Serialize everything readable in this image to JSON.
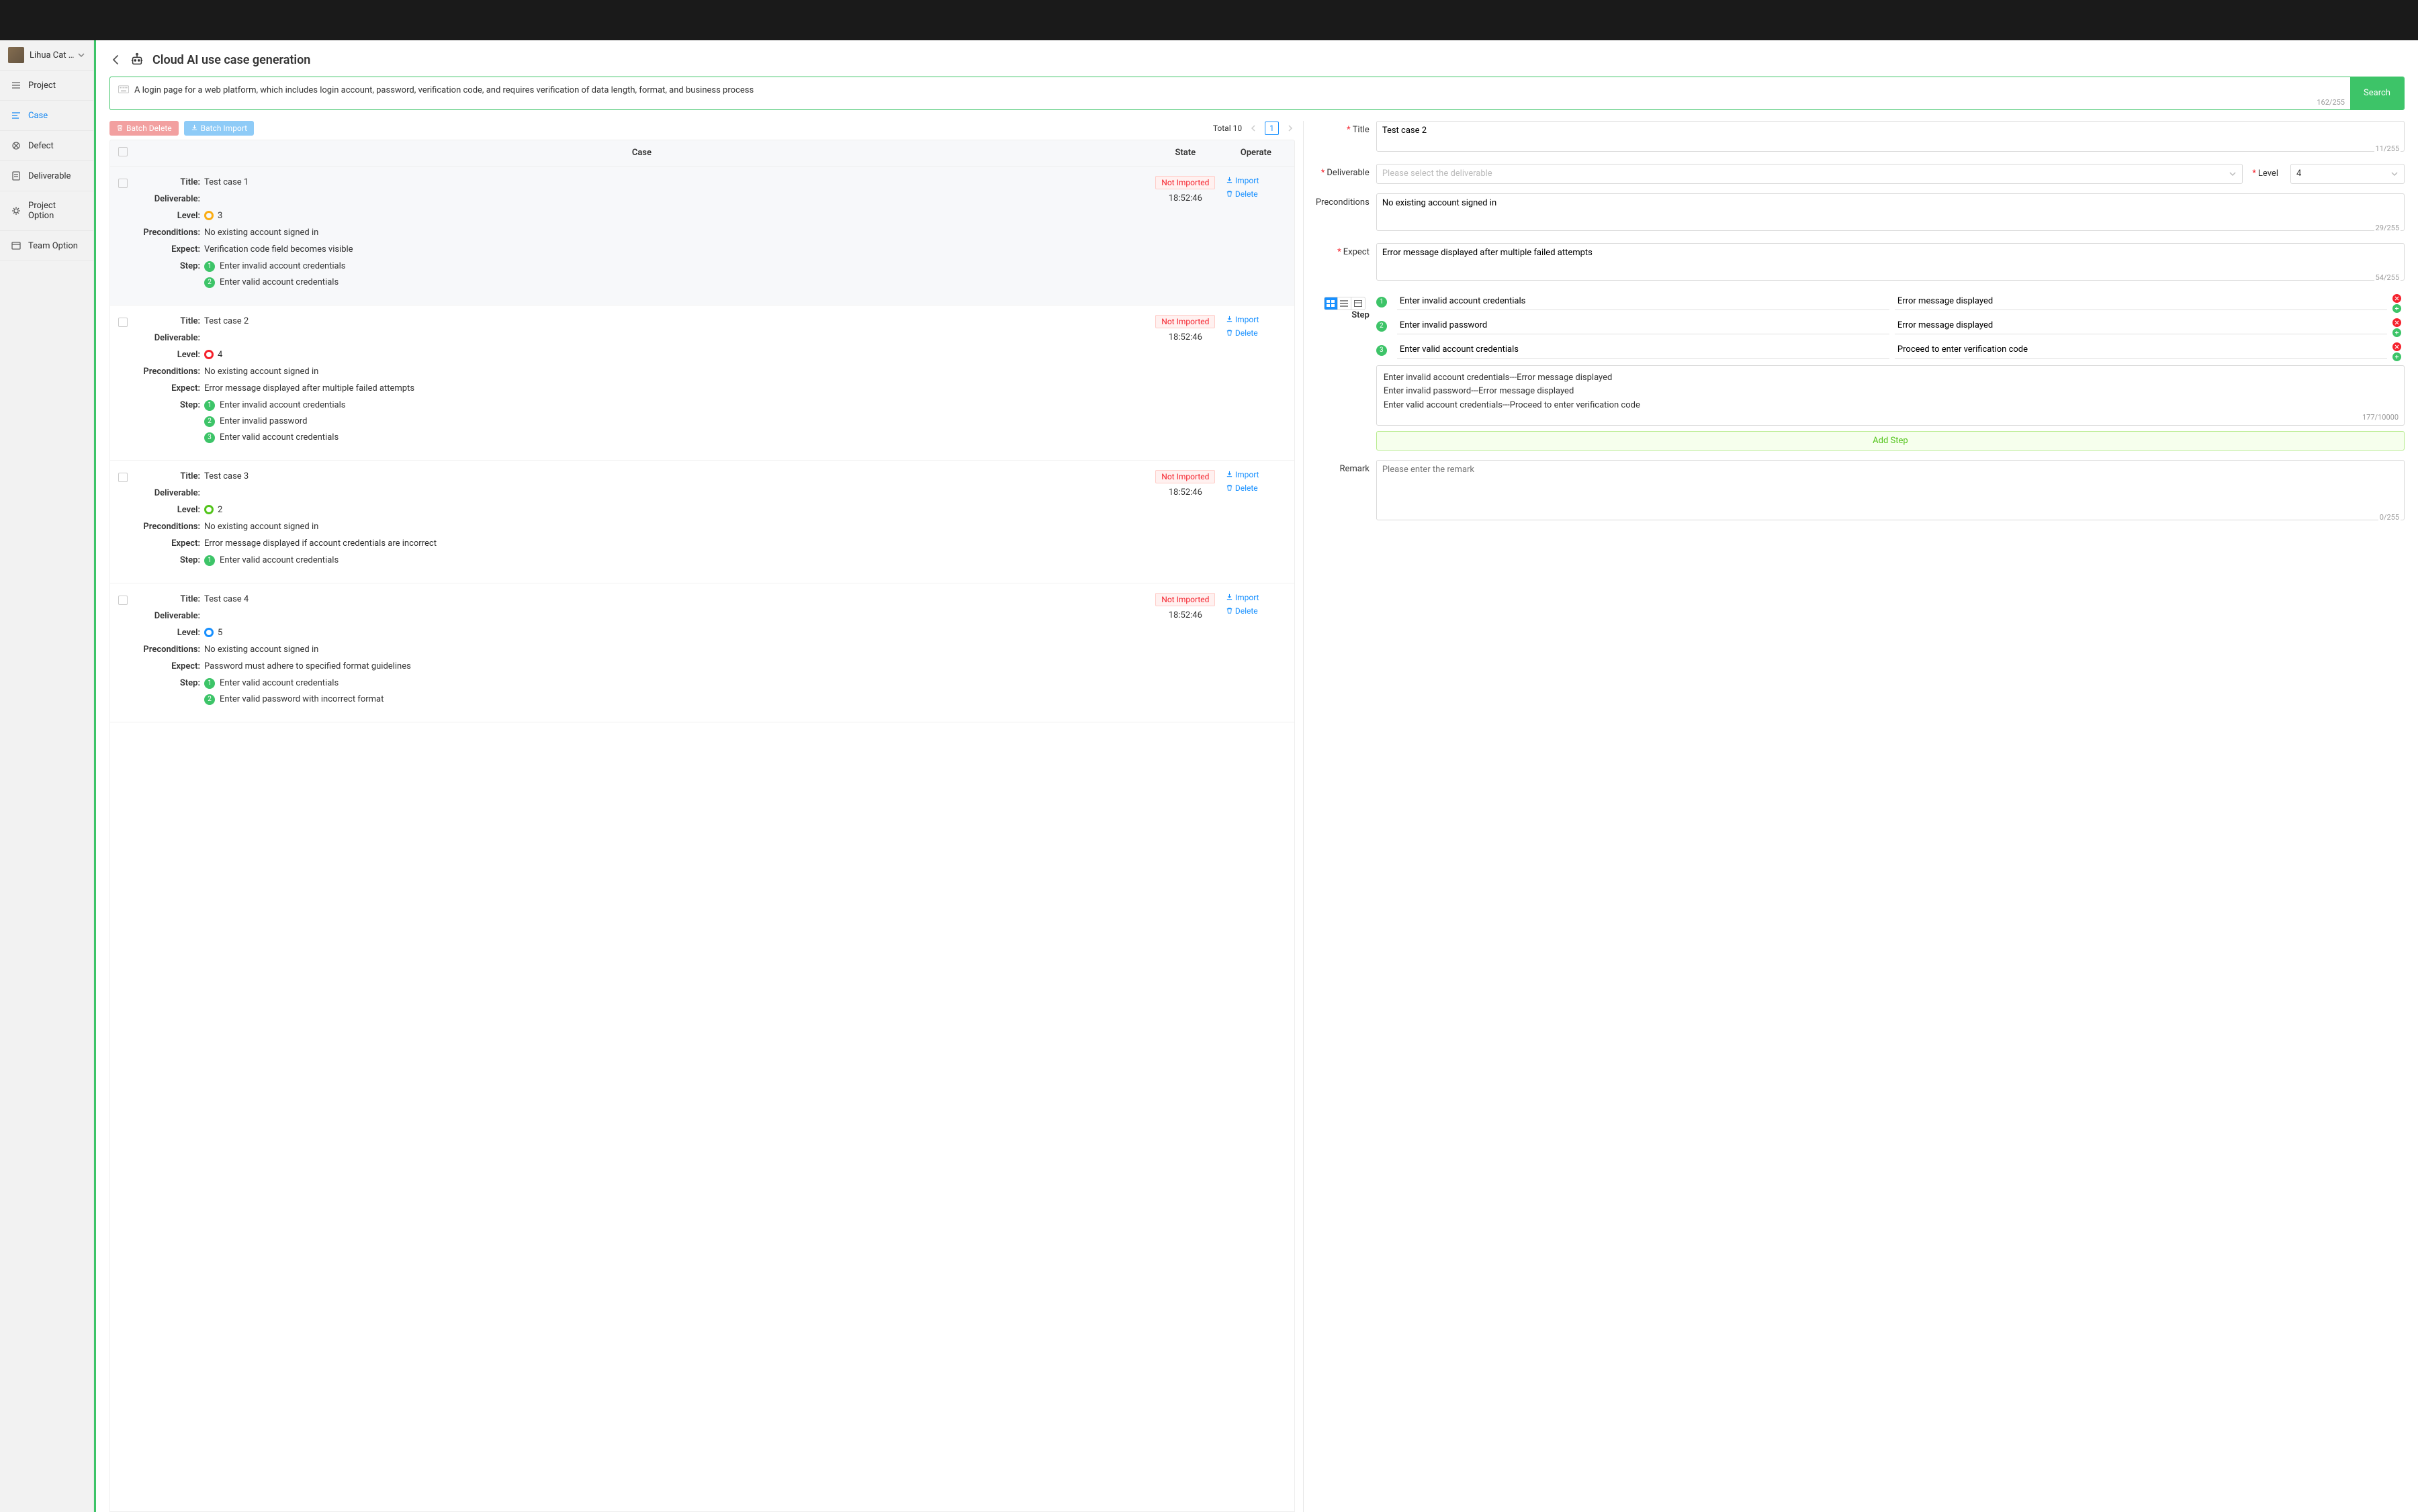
{
  "sidebar": {
    "project_name": "Lihua Cat A…",
    "items": [
      {
        "label": "Project"
      },
      {
        "label": "Case"
      },
      {
        "label": "Defect"
      },
      {
        "label": "Deliverable"
      },
      {
        "label": "Project Option"
      },
      {
        "label": "Team Option"
      }
    ]
  },
  "page": {
    "title": "Cloud AI use case generation",
    "search_text": "A login page for a web platform, which includes login account, password, verification code, and requires verification of data length, format, and business process",
    "search_count": "162/255",
    "search_btn": "Search"
  },
  "toolbar": {
    "batch_delete": "Batch Delete",
    "batch_import": "Batch Import",
    "total_label": "Total 10",
    "page": "1"
  },
  "list": {
    "headers": {
      "case": "Case",
      "state": "State",
      "operate": "Operate"
    },
    "field_labels": {
      "title": "Title:",
      "deliverable": "Deliverable:",
      "level": "Level:",
      "preconditions": "Preconditions:",
      "expect": "Expect:",
      "step": "Step:"
    },
    "state_not_imported": "Not Imported",
    "import_label": "Import",
    "delete_label": "Delete",
    "cases": [
      {
        "title": "Test case 1",
        "level": "3",
        "level_color": "#faad14",
        "preconditions": "No existing account signed in",
        "expect": "Verification code field becomes visible",
        "time": "18:52:46",
        "steps": [
          "Enter invalid account credentials",
          "Enter valid account credentials"
        ]
      },
      {
        "title": "Test case 2",
        "level": "4",
        "level_color": "#f5222d",
        "preconditions": "No existing account signed in",
        "expect": "Error message displayed after multiple failed attempts",
        "time": "18:52:46",
        "steps": [
          "Enter invalid account credentials",
          "Enter invalid password",
          "Enter valid account credentials"
        ]
      },
      {
        "title": "Test case 3",
        "level": "2",
        "level_color": "#52c41a",
        "preconditions": "No existing account signed in",
        "expect": "Error message displayed if account credentials are incorrect",
        "time": "18:52:46",
        "steps": [
          "Enter valid account credentials"
        ]
      },
      {
        "title": "Test case 4",
        "level": "5",
        "level_color": "#1890ff",
        "preconditions": "No existing account signed in",
        "expect": "Password must adhere to specified format guidelines",
        "time": "18:52:46",
        "steps": [
          "Enter valid account credentials",
          "Enter valid password with incorrect format"
        ]
      }
    ]
  },
  "detail": {
    "labels": {
      "title": "Title",
      "deliverable": "Deliverable",
      "level": "Level",
      "preconditions": "Preconditions",
      "expect": "Expect",
      "step": "Step",
      "remark": "Remark"
    },
    "title_value": "Test case 2",
    "title_count": "11/255",
    "deliverable_placeholder": "Please select the deliverable",
    "level_value": "4",
    "preconditions_value": "No existing account signed in",
    "preconditions_count": "29/255",
    "expect_value": "Error message displayed after multiple failed attempts",
    "expect_count": "54/255",
    "steps": [
      {
        "action": "Enter invalid account credentials",
        "result": "Error message displayed"
      },
      {
        "action": "Enter invalid password",
        "result": "Error message displayed"
      },
      {
        "action": "Enter valid account credentials",
        "result": "Proceed to enter verification code"
      }
    ],
    "step_summary_lines": [
      "Enter invalid account credentials---Error message displayed",
      "Enter invalid password---Error message displayed",
      "Enter valid account credentials---Proceed to enter verification code"
    ],
    "step_summary_count": "177/10000",
    "add_step": "Add Step",
    "remark_placeholder": "Please enter the remark",
    "remark_count": "0/255"
  }
}
